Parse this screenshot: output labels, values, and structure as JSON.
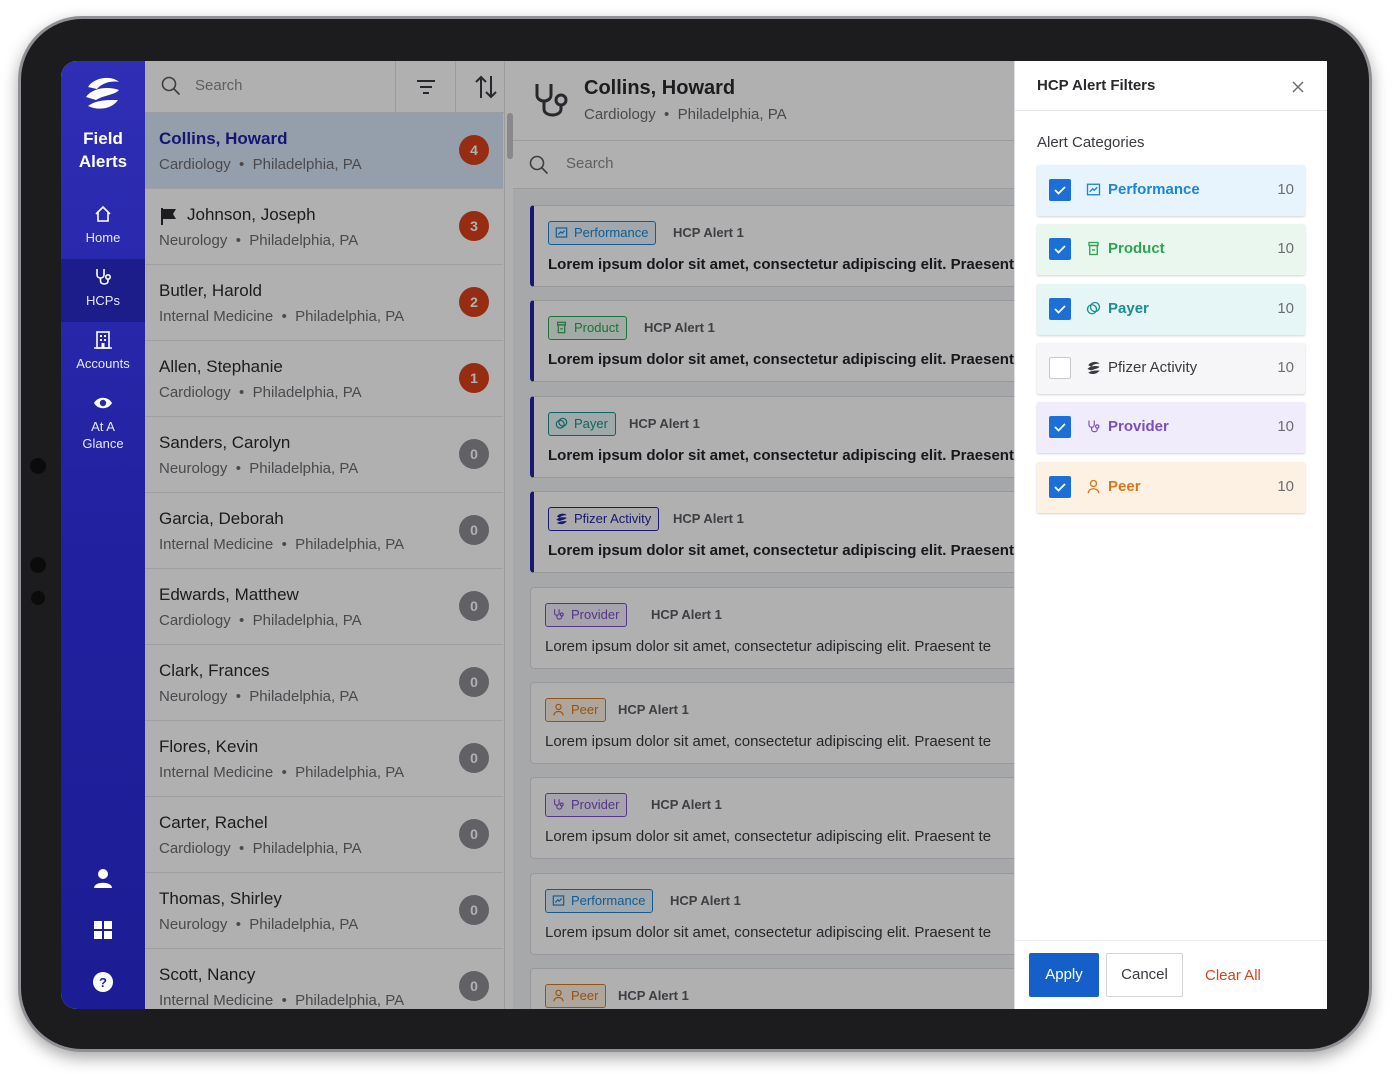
{
  "app": {
    "title": "Field Alerts"
  },
  "nav": {
    "items": [
      {
        "label": "Home",
        "icon": "home-icon"
      },
      {
        "label": "HCPs",
        "icon": "stethoscope-icon"
      },
      {
        "label": "Accounts",
        "icon": "building-icon"
      },
      {
        "label": "At A Glance",
        "icon": "eye-icon"
      }
    ],
    "active": "HCPs",
    "bottom_icons": [
      "user-icon",
      "grid-icon",
      "help-icon"
    ]
  },
  "list": {
    "search_placeholder": "Search",
    "hcps": [
      {
        "name": "Collins, Howard",
        "specialty": "Cardiology",
        "location": "Philadelphia, PA",
        "count": "4",
        "selected": true
      },
      {
        "name": "Johnson, Joseph",
        "specialty": "Neurology",
        "location": "Philadelphia, PA",
        "count": "3",
        "flagged": true
      },
      {
        "name": "Butler, Harold",
        "specialty": "Internal Medicine",
        "location": "Philadelphia, PA",
        "count": "2"
      },
      {
        "name": "Allen, Stephanie",
        "specialty": "Cardiology",
        "location": "Philadelphia, PA",
        "count": "1"
      },
      {
        "name": "Sanders, Carolyn",
        "specialty": "Neurology",
        "location": "Philadelphia, PA",
        "count": "0"
      },
      {
        "name": "Garcia, Deborah",
        "specialty": "Internal Medicine",
        "location": "Philadelphia, PA",
        "count": "0"
      },
      {
        "name": "Edwards, Matthew",
        "specialty": "Cardiology",
        "location": "Philadelphia, PA",
        "count": "0"
      },
      {
        "name": "Clark, Frances",
        "specialty": "Neurology",
        "location": "Philadelphia, PA",
        "count": "0"
      },
      {
        "name": "Flores, Kevin",
        "specialty": "Internal Medicine",
        "location": "Philadelphia, PA",
        "count": "0"
      },
      {
        "name": "Carter, Rachel",
        "specialty": "Cardiology",
        "location": "Philadelphia, PA",
        "count": "0"
      },
      {
        "name": "Thomas, Shirley",
        "specialty": "Neurology",
        "location": "Philadelphia, PA",
        "count": "0"
      },
      {
        "name": "Scott, Nancy",
        "specialty": "Internal Medicine",
        "location": "Philadelphia, PA",
        "count": "0"
      }
    ]
  },
  "detail": {
    "name": "Collins, Howard",
    "specialty": "Cardiology",
    "location": "Philadelphia, PA",
    "search_placeholder": "Search",
    "alerts": [
      {
        "category": "Performance",
        "title": "HCP Alert 1",
        "body": "Lorem ipsum dolor sit amet, consectetur adipiscing elit. Praesent te",
        "unread": true
      },
      {
        "category": "Product",
        "title": "HCP Alert 1",
        "body": "Lorem ipsum dolor sit amet, consectetur adipiscing elit. Praesent te",
        "unread": true
      },
      {
        "category": "Payer",
        "title": "HCP Alert 1",
        "body": "Lorem ipsum dolor sit amet, consectetur adipiscing elit. Praesent te",
        "unread": true
      },
      {
        "category": "Pfizer Activity",
        "title": "HCP Alert 1",
        "body": "Lorem ipsum dolor sit amet, consectetur adipiscing elit. Praesent te",
        "unread": true
      },
      {
        "category": "Provider",
        "title": "HCP Alert 1",
        "body": "Lorem ipsum dolor sit amet, consectetur adipiscing elit. Praesent te",
        "unread": false
      },
      {
        "category": "Peer",
        "title": "HCP Alert 1",
        "body": "Lorem ipsum dolor sit amet, consectetur adipiscing elit. Praesent te",
        "unread": false
      },
      {
        "category": "Provider",
        "title": "HCP Alert 1",
        "body": "Lorem ipsum dolor sit amet, consectetur adipiscing elit. Praesent te",
        "unread": false
      },
      {
        "category": "Performance",
        "title": "HCP Alert 1",
        "body": "Lorem ipsum dolor sit amet, consectetur adipiscing elit. Praesent te",
        "unread": false
      },
      {
        "category": "Peer",
        "title": "HCP Alert 1",
        "body": "",
        "unread": false
      }
    ]
  },
  "filters": {
    "title": "HCP Alert Filters",
    "section_label": "Alert Categories",
    "categories": [
      {
        "label": "Performance",
        "count": "10",
        "checked": true,
        "color": "#1a86d4",
        "bg": "#e8f4fd",
        "icon": "chart-icon"
      },
      {
        "label": "Product",
        "count": "10",
        "checked": true,
        "color": "#2da550",
        "bg": "#eaf7ee",
        "icon": "pill-bottle-icon"
      },
      {
        "label": "Payer",
        "count": "10",
        "checked": true,
        "color": "#1c8f8f",
        "bg": "#e6f5f5",
        "icon": "coins-icon"
      },
      {
        "label": "Pfizer Activity",
        "count": "10",
        "checked": false,
        "color": "#3a3a40",
        "bg": "#f6f6f8",
        "icon": "pfizer-logo-icon"
      },
      {
        "label": "Provider",
        "count": "10",
        "checked": true,
        "color": "#7a4fc4",
        "bg": "#f1ecfb",
        "icon": "stethoscope-icon"
      },
      {
        "label": "Peer",
        "count": "10",
        "checked": true,
        "color": "#d8781a",
        "bg": "#fdf1e4",
        "icon": "person-icon"
      }
    ],
    "apply_label": "Apply",
    "cancel_label": "Cancel",
    "clear_label": "Clear All"
  }
}
